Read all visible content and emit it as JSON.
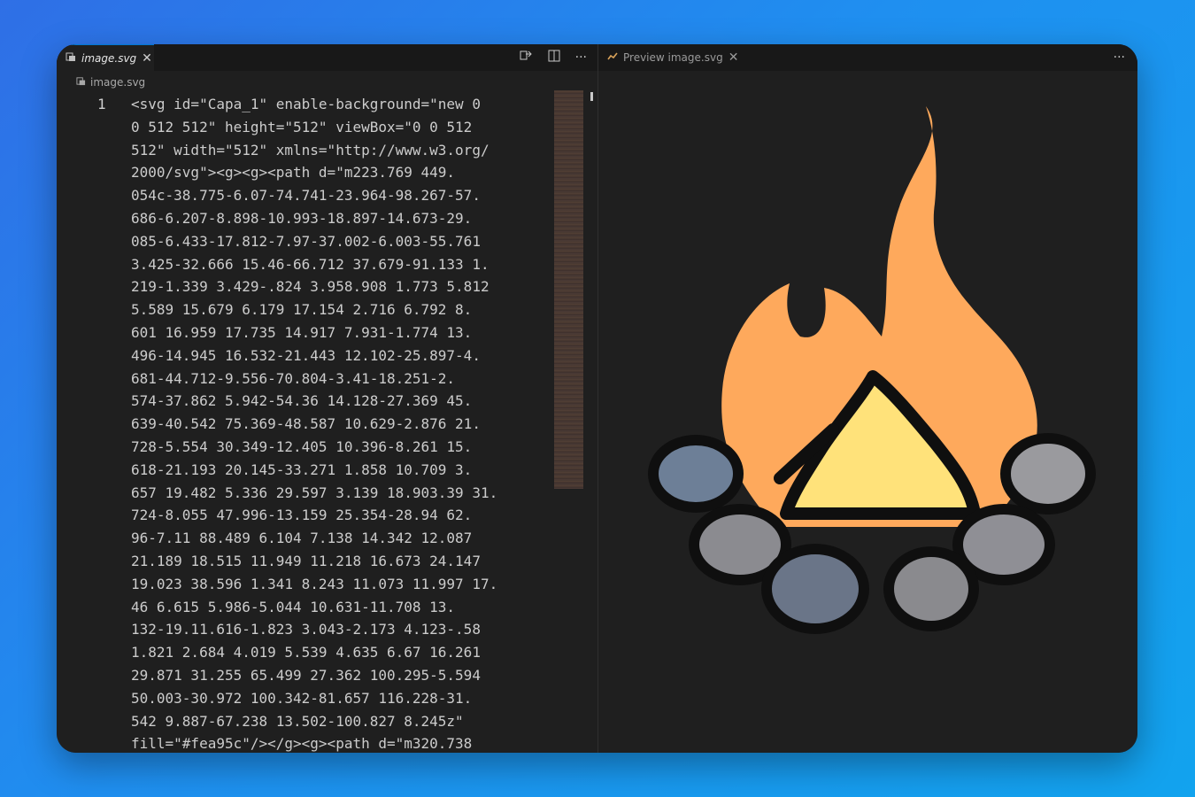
{
  "editor": {
    "tab": {
      "label": "image.svg",
      "close": "✕",
      "icon": "svg-file-icon"
    },
    "breadcrumb": {
      "label": "image.svg",
      "icon": "svg-file-icon"
    },
    "actions": [
      "compare-icon",
      "split-editor-icon",
      "more-actions-icon"
    ],
    "line_number": "1",
    "code_lines": [
      "<svg id=\"Capa_1\" enable-background=\"new 0",
      "0 512 512\" height=\"512\" viewBox=\"0 0 512",
      "512\" width=\"512\" xmlns=\"http://www.w3.org/",
      "2000/svg\"><g><g><path d=\"m223.769 449.",
      "054c-38.775-6.07-74.741-23.964-98.267-57.",
      "686-6.207-8.898-10.993-18.897-14.673-29.",
      "085-6.433-17.812-7.97-37.002-6.003-55.761",
      "3.425-32.666 15.46-66.712 37.679-91.133 1.",
      "219-1.339 3.429-.824 3.958.908 1.773 5.812",
      "5.589 15.679 6.179 17.154 2.716 6.792 8.",
      "601 16.959 17.735 14.917 7.931-1.774 13.",
      "496-14.945 16.532-21.443 12.102-25.897-4.",
      "681-44.712-9.556-70.804-3.41-18.251-2.",
      "574-37.862 5.942-54.36 14.128-27.369 45.",
      "639-40.542 75.369-48.587 10.629-2.876 21.",
      "728-5.554 30.349-12.405 10.396-8.261 15.",
      "618-21.193 20.145-33.271 1.858 10.709 3.",
      "657 19.482 5.336 29.597 3.139 18.903.39 31.",
      "724-8.055 47.996-13.159 25.354-28.94 62.",
      "96-7.11 88.489 6.104 7.138 14.342 12.087",
      "21.189 18.515 11.949 11.218 16.673 24.147",
      "19.023 38.596 1.341 8.243 11.073 11.997 17.",
      "46 6.615 5.986-5.044 10.631-11.708 13.",
      "132-19.11.616-1.823 3.043-2.173 4.123-.58",
      "1.821 2.684 4.019 5.539 4.635 6.67 16.261",
      "29.871 31.255 65.499 27.362 100.295-5.594",
      "50.003-30.972 100.342-81.657 116.228-31.",
      "542 9.887-67.238 13.502-100.827 8.245z\"",
      "fill=\"#fea95c\"/></g><g><path d=\"m320.738"
    ]
  },
  "preview": {
    "tab": {
      "label": "Preview image.svg",
      "close": "✕",
      "icon": "preview-icon"
    },
    "actions": [
      "more-actions-icon"
    ],
    "image": {
      "name": "campfire-icon",
      "colors": {
        "flame_outer": "#fea95c",
        "flame_inner": "#ffe27a",
        "stone_dark": "#7a7e86",
        "stone_light": "#9a9a9e",
        "stone_blue": "#6a7588",
        "outline": "#0f0f0f"
      }
    }
  }
}
